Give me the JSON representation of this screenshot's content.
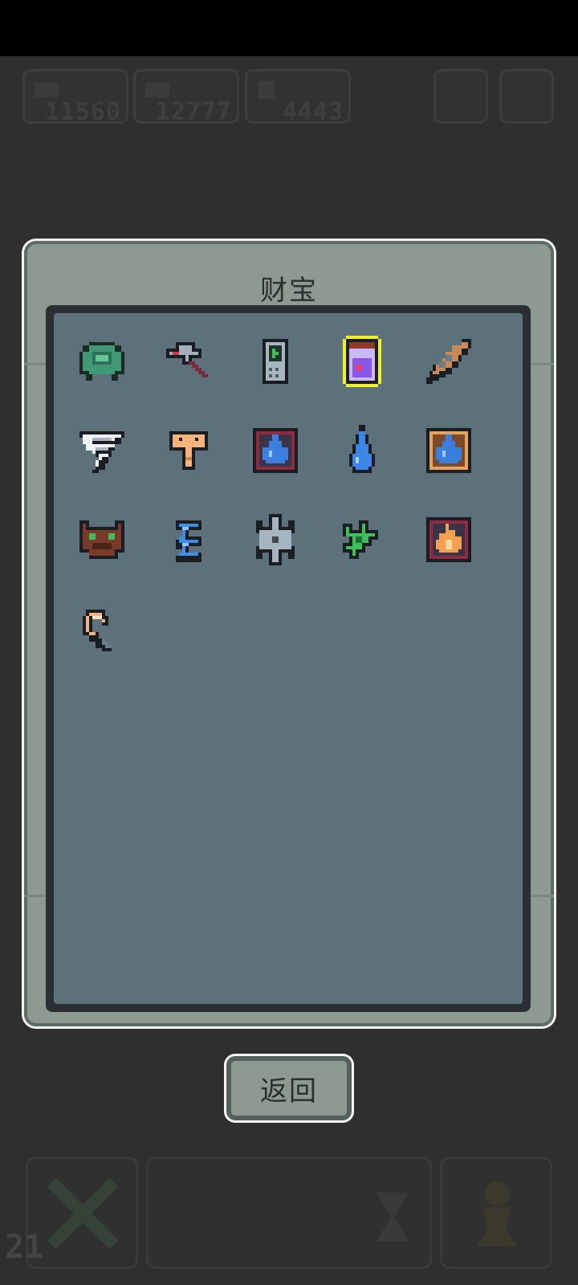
{
  "hud": {
    "resource_1": "11560",
    "resource_2": "12777",
    "resource_3": "4443",
    "level": "21"
  },
  "modal": {
    "title": "财宝",
    "back_label": "返回"
  },
  "treasures": [
    {
      "name": "green-shell-helmet-icon",
      "selected": false
    },
    {
      "name": "hammer-icon",
      "selected": false
    },
    {
      "name": "handheld-device-icon",
      "selected": false
    },
    {
      "name": "potion-jar-icon",
      "selected": true
    },
    {
      "name": "dagger-icon",
      "selected": false
    },
    {
      "name": "tornado-icon",
      "selected": false
    },
    {
      "name": "key-icon",
      "selected": false
    },
    {
      "name": "water-rune-dark-icon",
      "selected": false
    },
    {
      "name": "water-drop-icon",
      "selected": false
    },
    {
      "name": "water-rune-gold-icon",
      "selected": false
    },
    {
      "name": "brown-beast-mask-icon",
      "selected": false
    },
    {
      "name": "blue-feather-icon",
      "selected": false
    },
    {
      "name": "shuriken-icon",
      "selected": false
    },
    {
      "name": "green-claw-icon",
      "selected": false
    },
    {
      "name": "fire-rune-icon",
      "selected": false
    },
    {
      "name": "shrimp-hook-icon",
      "selected": false
    }
  ]
}
